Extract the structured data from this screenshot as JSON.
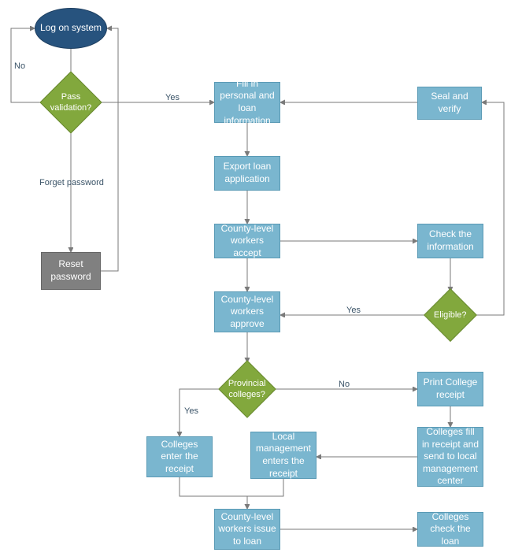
{
  "chart_data": {
    "type": "flowchart",
    "nodes": [
      {
        "id": "start",
        "shape": "terminator",
        "label": "Log on system"
      },
      {
        "id": "pass",
        "shape": "decision",
        "label": "Pass validation?"
      },
      {
        "id": "forget",
        "shape": "label",
        "label": "Forget password"
      },
      {
        "id": "reset",
        "shape": "process",
        "label": "Reset password"
      },
      {
        "id": "fill",
        "shape": "process",
        "label": "Fill in personal and loan information"
      },
      {
        "id": "seal",
        "shape": "process",
        "label": "Seal and verify"
      },
      {
        "id": "export",
        "shape": "process",
        "label": "Export loan application"
      },
      {
        "id": "accept",
        "shape": "process",
        "label": "County-level workers accept"
      },
      {
        "id": "check",
        "shape": "process",
        "label": "Check the information"
      },
      {
        "id": "eligible",
        "shape": "decision",
        "label": "Eligible?"
      },
      {
        "id": "approve",
        "shape": "process",
        "label": "County-level workers approve"
      },
      {
        "id": "provincial",
        "shape": "decision",
        "label": "Provincial colleges?"
      },
      {
        "id": "print",
        "shape": "process",
        "label": "Print College receipt"
      },
      {
        "id": "send",
        "shape": "process",
        "label": "Colleges fill in receipt and send to local management center"
      },
      {
        "id": "enter",
        "shape": "process",
        "label": "Colleges enter the receipt"
      },
      {
        "id": "local",
        "shape": "process",
        "label": "Local management enters the receipt"
      },
      {
        "id": "issue",
        "shape": "process",
        "label": "County-level workers issue to loan"
      },
      {
        "id": "checkloan",
        "shape": "process",
        "label": "Colleges check the loan"
      }
    ],
    "edges": [
      {
        "from": "start",
        "to": "pass"
      },
      {
        "from": "pass",
        "to": "start",
        "label": "No"
      },
      {
        "from": "pass",
        "to": "fill",
        "label": "Yes"
      },
      {
        "from": "pass",
        "to": "reset",
        "via": "forget"
      },
      {
        "from": "reset",
        "to": "start"
      },
      {
        "from": "fill",
        "to": "export"
      },
      {
        "from": "export",
        "to": "accept"
      },
      {
        "from": "accept",
        "to": "check"
      },
      {
        "from": "accept",
        "to": "approve"
      },
      {
        "from": "check",
        "to": "eligible"
      },
      {
        "from": "eligible",
        "to": "approve",
        "label": "Yes"
      },
      {
        "from": "eligible",
        "to": "seal",
        "label": "(no-label loop)"
      },
      {
        "from": "seal",
        "to": "fill"
      },
      {
        "from": "approve",
        "to": "provincial"
      },
      {
        "from": "provincial",
        "to": "enter",
        "label": "Yes"
      },
      {
        "from": "provincial",
        "to": "print",
        "label": "No"
      },
      {
        "from": "print",
        "to": "send"
      },
      {
        "from": "send",
        "to": "local"
      },
      {
        "from": "enter",
        "to": "issue"
      },
      {
        "from": "local",
        "to": "issue"
      },
      {
        "from": "issue",
        "to": "checkloan"
      }
    ]
  },
  "labels": {
    "start": "Log on system",
    "pass": "Pass validation?",
    "forget": "Forget password",
    "reset": "Reset password",
    "fill": "Fill in personal and loan information",
    "seal": "Seal and verify",
    "export": "Export loan application",
    "accept": "County-level workers accept",
    "check": "Check the information",
    "eligible": "Eligible?",
    "approve": "County-level workers approve",
    "provincial": "Provincial colleges?",
    "print": "Print College receipt",
    "send": "Colleges fill in receipt and send to local management center",
    "enter": "Colleges enter the receipt",
    "local": "Local management enters the receipt",
    "issue": "County-level workers issue to loan",
    "checkloan": "Colleges check the loan",
    "no": "No",
    "yes": "Yes",
    "yes2": "Yes",
    "yes3": "Yes",
    "no2": "No"
  }
}
